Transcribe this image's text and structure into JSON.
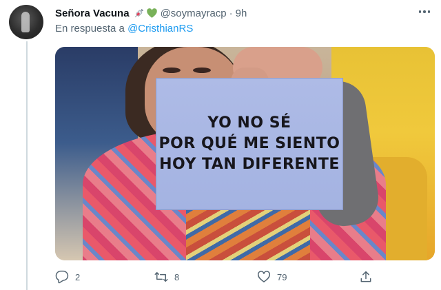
{
  "author": {
    "display_name": "Señora Vacuna",
    "emojis": [
      "syringe-emoji",
      "green-heart-emoji"
    ],
    "handle": "@soymayracp",
    "separator": "·",
    "time": "9h"
  },
  "reply_to": {
    "prefix": "En respuesta a",
    "mention": "@CristhianRS"
  },
  "media": {
    "sign_lines": [
      "YO NO SÉ",
      "POR QUÉ ME SIENTO",
      "HOY TAN DIFERENTE"
    ]
  },
  "actions": {
    "reply_count": "2",
    "retweet_count": "8",
    "like_count": "79"
  },
  "colors": {
    "link": "#1d9bf0",
    "secondary_text": "#536471",
    "sign_paper": "#a9b7e4"
  }
}
